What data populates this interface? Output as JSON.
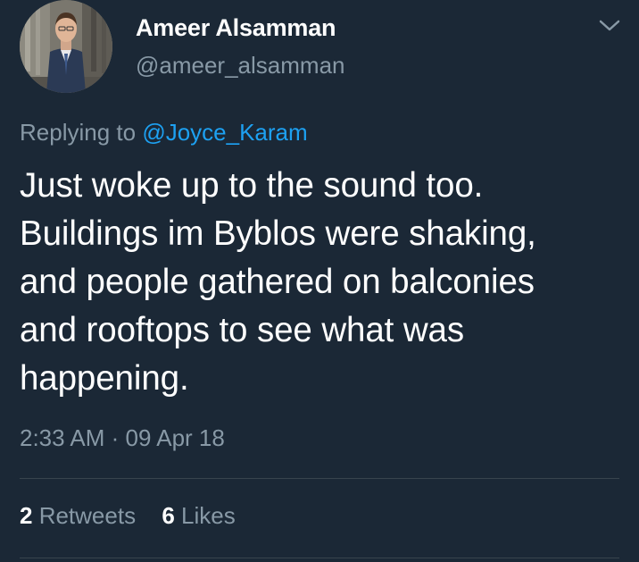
{
  "tweet": {
    "author": {
      "display_name": "Ameer Alsamman",
      "handle": "@ameer_alsamman",
      "avatar_icon": "profile-photo"
    },
    "menu_icon": "chevron-down-icon",
    "reply": {
      "prefix": "Replying to ",
      "mention": "@Joyce_Karam"
    },
    "text_lines": [
      "Just woke up to the sound too.",
      "Buildings im Byblos were shaking,",
      "and people gathered on balconies",
      "and rooftops to see what was",
      "happening."
    ],
    "time": "2:33 AM",
    "separator": " · ",
    "date": "09 Apr 18",
    "stats": {
      "retweets_count": "2",
      "retweets_label": " Retweets",
      "likes_count": "6",
      "likes_label": " Likes"
    }
  },
  "colors": {
    "background": "#1b2836",
    "primary_text": "#ffffff",
    "secondary_text": "#8899a6",
    "link": "#1da1f2",
    "divider": "#38444d"
  }
}
